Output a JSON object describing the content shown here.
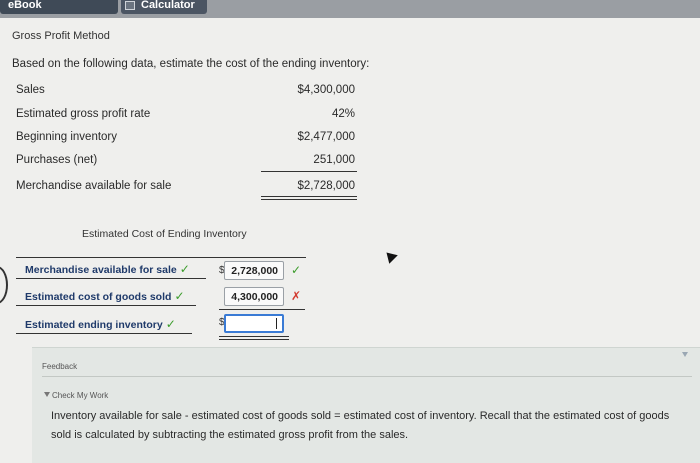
{
  "tabs": {
    "ebook": "eBook",
    "calculator": "Calculator"
  },
  "title": "Gross Profit Method",
  "intro": "Based on the following data, estimate the cost of the ending inventory:",
  "data_rows": [
    {
      "label": "Sales",
      "value": "$4,300,000"
    },
    {
      "label": "Estimated gross profit rate",
      "value": "42%"
    },
    {
      "label": "Beginning inventory",
      "value": "$2,477,000"
    },
    {
      "label": "Purchases (net)",
      "value": "251,000"
    },
    {
      "label": "Merchandise available for sale",
      "value": "$2,728,000"
    }
  ],
  "calc": {
    "title": "Estimated Cost of Ending Inventory",
    "rows": [
      {
        "label": "Merchandise available for sale",
        "label_check": "✓",
        "dollar": "$",
        "value": "2,728,000",
        "status": "✓"
      },
      {
        "label": "Estimated cost of goods sold",
        "label_check": "✓",
        "dollar": "",
        "value": "4,300,000",
        "status": "✗"
      },
      {
        "label": "Estimated ending inventory",
        "label_check": "✓",
        "dollar": "$",
        "value": ""
      }
    ]
  },
  "feedback": {
    "label": "Feedback",
    "check_my_work": "Check My Work",
    "text": "Inventory available for sale - estimated cost of goods sold = estimated cost of inventory. Recall that the estimated cost of goods sold is calculated by subtracting the estimated gross profit from the sales."
  },
  "colors": {
    "check": "#3b9c2b",
    "error": "#d23a2f",
    "label_blue": "#1f3a6a",
    "input_border": "#3a7bd5"
  }
}
